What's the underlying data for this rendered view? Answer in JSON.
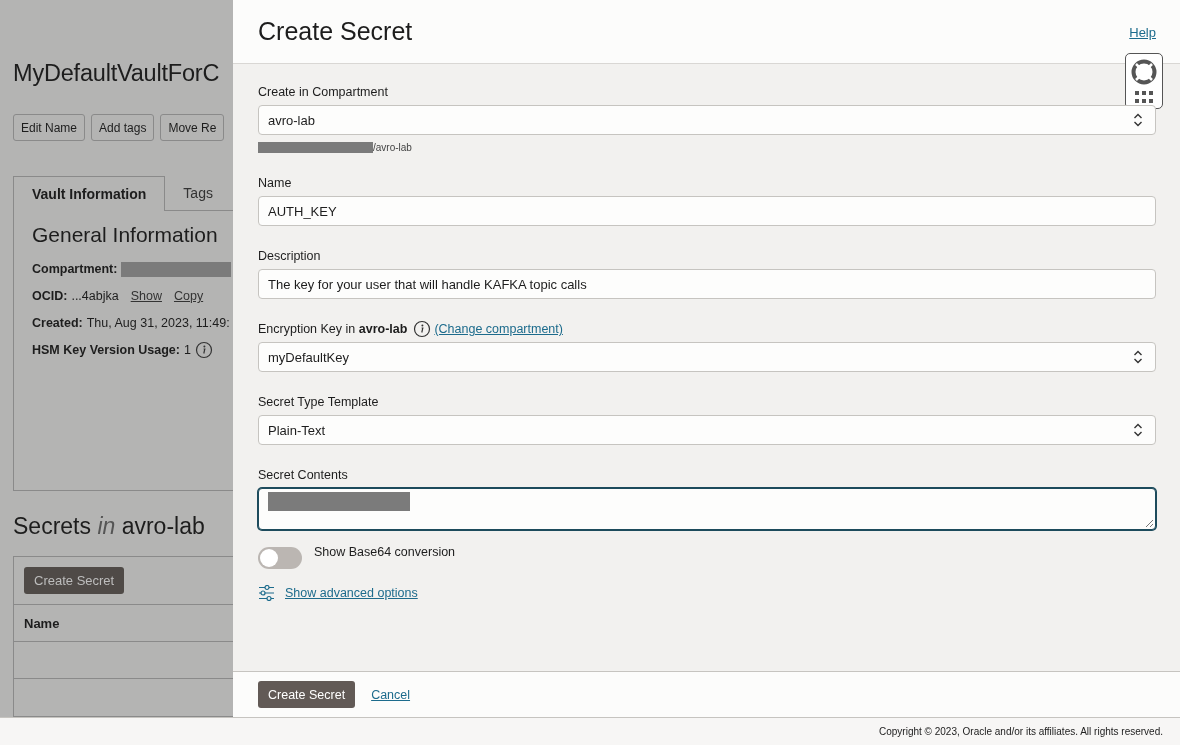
{
  "page": {
    "title": "MyDefaultVaultForC",
    "actions": [
      "Edit Name",
      "Add tags",
      "Move Re"
    ],
    "tabs": [
      {
        "label": "Vault Information",
        "selected": true
      },
      {
        "label": "Tags",
        "selected": false
      }
    ],
    "general": {
      "heading": "General Information",
      "rows": [
        {
          "label": "Compartment:",
          "redacted": true,
          "links": [],
          "info": false
        },
        {
          "label": "OCID:",
          "value": "...4abjka",
          "redacted": false,
          "links": [
            "Show",
            "Copy"
          ],
          "info": false
        },
        {
          "label": "Created:",
          "value": "Thu, Aug 31, 2023, 11:49:",
          "redacted": false,
          "links": [],
          "info": false
        },
        {
          "label": "HSM Key Version Usage:",
          "value": "1",
          "redacted": false,
          "links": [],
          "info": true
        }
      ]
    },
    "secrets_heading": {
      "before": "Secrets",
      "italic": "in",
      "after": "avro-lab"
    },
    "create_button": "Create Secret",
    "table": {
      "columns": [
        "Name"
      ]
    }
  },
  "drawer": {
    "title": "Create Secret",
    "help": "Help",
    "fields": [
      {
        "kind": "select",
        "label": "Create in Compartment",
        "value": "avro-lab",
        "hint": "/avro-lab",
        "hint_redacted": true
      },
      {
        "kind": "input",
        "label": "Name",
        "value": "AUTH_KEY"
      },
      {
        "kind": "input",
        "label": "Description",
        "value": "The key for your user that will handle KAFKA topic calls"
      },
      {
        "kind": "select",
        "label": "Encryption Key in **avro-lab**",
        "value": "myDefaultKey",
        "info": true,
        "link": "(Change compartment)"
      },
      {
        "kind": "select",
        "label": "Secret Type Template",
        "value": "Plain-Text"
      },
      {
        "kind": "textarea",
        "label": "Secret Contents",
        "value_redacted": true,
        "focused": true
      }
    ],
    "toggle": {
      "label": "Show Base64 conversion",
      "on": false
    },
    "advanced": "Show advanced options",
    "buttons": {
      "primary": "Create Secret",
      "cancel": "Cancel"
    }
  },
  "footer": {
    "copyright": "Copyright © 2023, Oracle and/or its affiliates. All rights reserved."
  }
}
